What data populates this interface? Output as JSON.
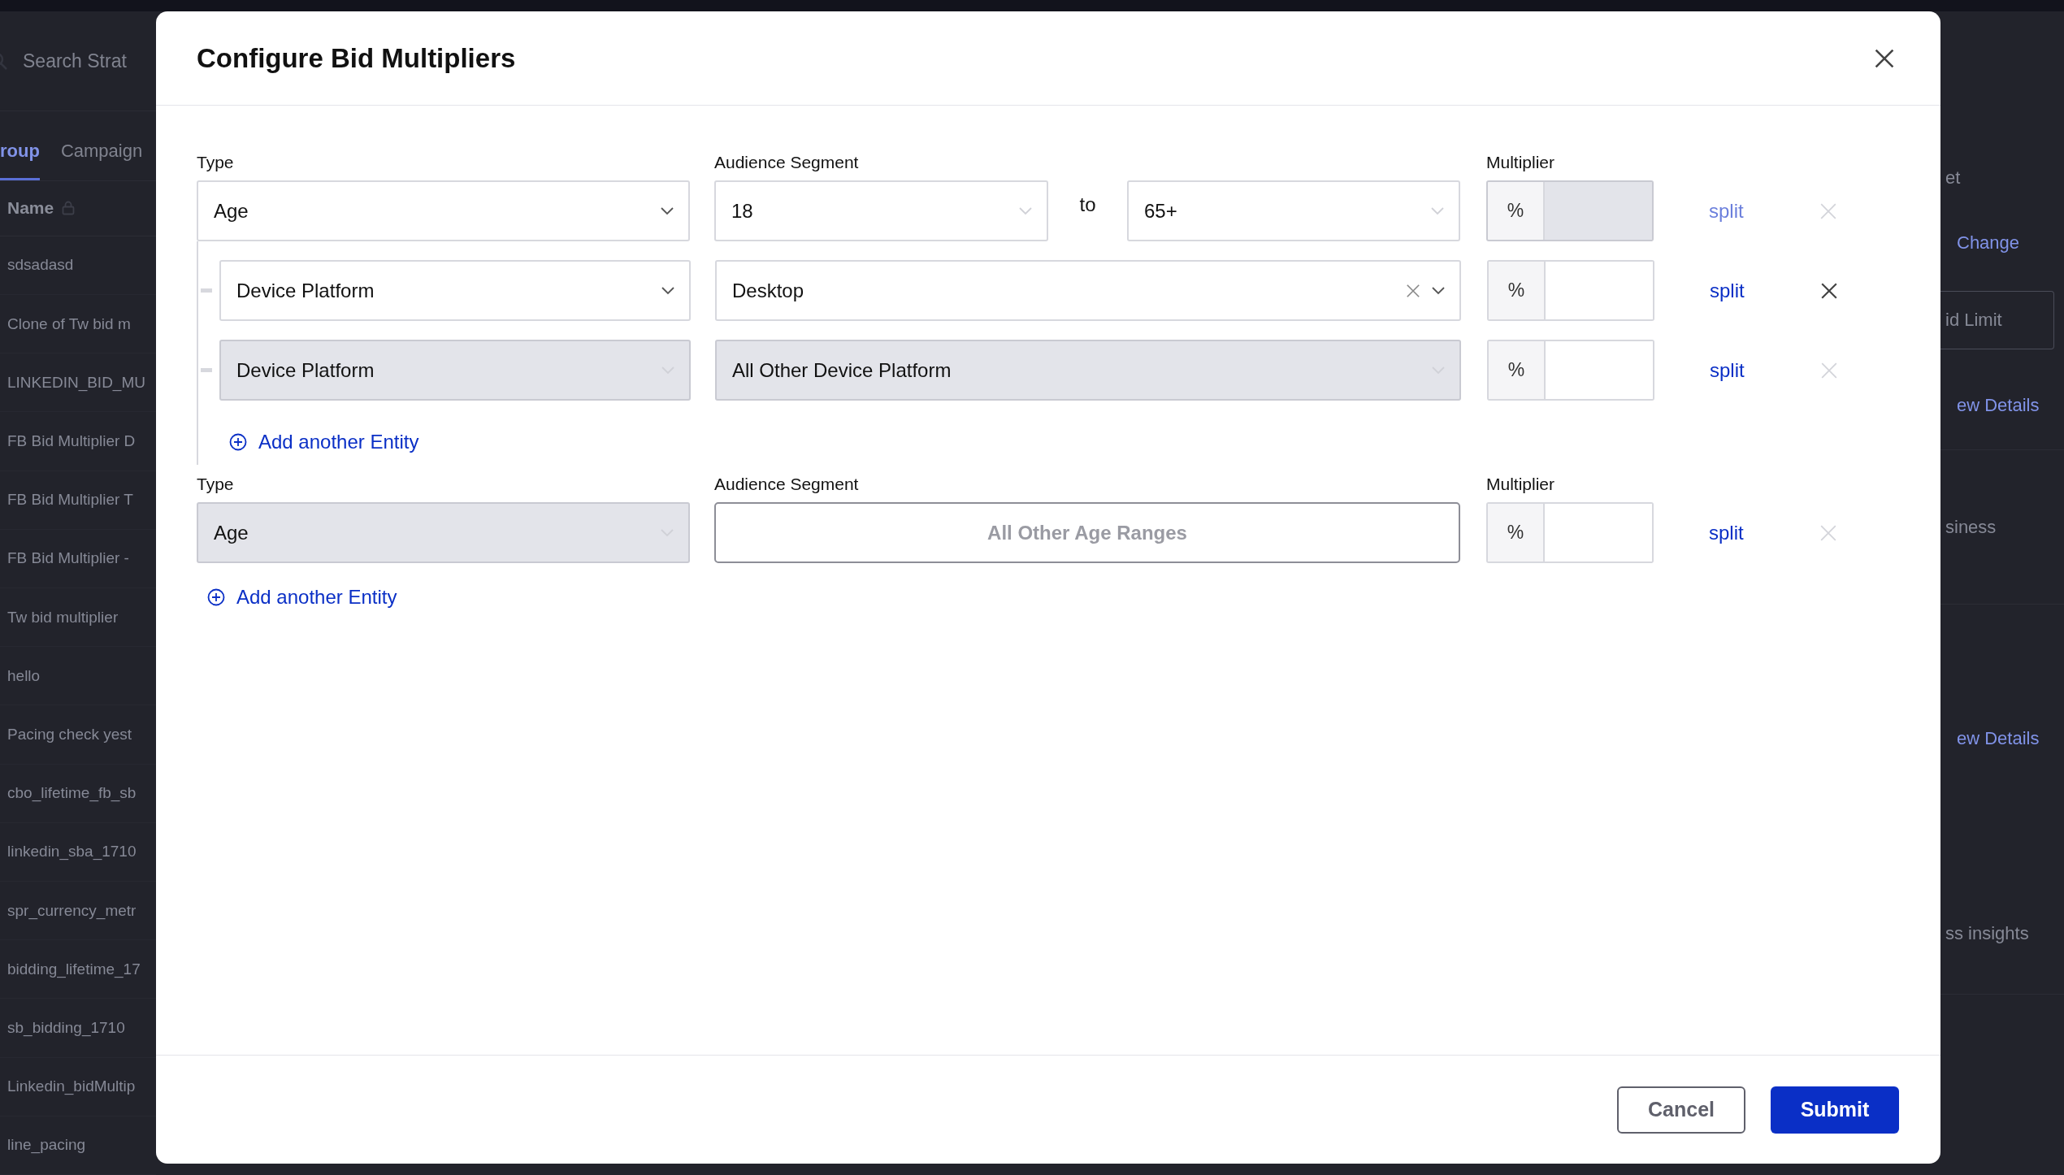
{
  "background": {
    "search": {
      "placeholder": "Search Strat"
    },
    "tabs": [
      {
        "label": "roup",
        "selected": true
      },
      {
        "label": "Campaign",
        "selected": false
      }
    ],
    "column_header": "Name",
    "rows": [
      "sdsadasd",
      "Clone of Tw bid m",
      "LINKEDIN_BID_MU",
      "FB Bid Multiplier D",
      "FB Bid Multiplier T",
      "FB Bid Multiplier -",
      "Tw bid multiplier",
      "hello",
      "Pacing check yest",
      "cbo_lifetime_fb_sb",
      "linkedin_sba_1710",
      "spr_currency_metr",
      "bidding_lifetime_17",
      "sb_bidding_1710",
      "Linkedin_bidMultip",
      "line_pacing"
    ],
    "right_items": [
      {
        "kind": "text",
        "text": "et"
      },
      {
        "kind": "link",
        "text": "Change"
      },
      {
        "kind": "button",
        "text": "id Limit"
      },
      {
        "kind": "link",
        "text": "ew Details"
      },
      {
        "kind": "text",
        "text": "siness"
      },
      {
        "kind": "link",
        "text": "ew Details"
      },
      {
        "kind": "text",
        "text": "ss insights"
      }
    ]
  },
  "dialog": {
    "title": "Configure Bid Multipliers",
    "groups": [
      {
        "labels": {
          "type": "Type",
          "segment": "Audience Segment",
          "multiplier": "Multiplier"
        },
        "type": {
          "value": "Age",
          "disabled": false
        },
        "segment": {
          "kind": "range",
          "from": "18",
          "separator": "to",
          "to": "65+"
        },
        "multiplier": {
          "unit": "%",
          "disabled": true
        },
        "split": {
          "label": "split",
          "disabled": true
        },
        "remove_enabled": false,
        "children": [
          {
            "type": {
              "value": "Device Platform",
              "disabled": false
            },
            "segment": {
              "kind": "select",
              "value": "Desktop",
              "disabled": false,
              "clearable": true
            },
            "multiplier": {
              "unit": "%",
              "disabled": false
            },
            "split": {
              "label": "split",
              "disabled": false
            },
            "remove_enabled": true
          },
          {
            "type": {
              "value": "Device Platform",
              "disabled": true
            },
            "segment": {
              "kind": "select",
              "value": "All Other Device Platform",
              "disabled": true,
              "clearable": false
            },
            "multiplier": {
              "unit": "%",
              "disabled": false
            },
            "split": {
              "label": "split",
              "disabled": false
            },
            "remove_enabled": false
          }
        ],
        "add_child": "Add another Entity"
      },
      {
        "labels": {
          "type": "Type",
          "segment": "Audience Segment",
          "multiplier": "Multiplier"
        },
        "type": {
          "value": "Age",
          "disabled": true
        },
        "segment": {
          "kind": "static",
          "value": "All Other Age Ranges"
        },
        "multiplier": {
          "unit": "%",
          "disabled": false
        },
        "split": {
          "label": "split",
          "disabled": false
        },
        "remove_enabled": false
      }
    ],
    "add_group": "Add another Entity",
    "buttons": [
      {
        "label": "Cancel",
        "kind": "secondary"
      },
      {
        "label": "Submit",
        "kind": "primary"
      }
    ]
  }
}
